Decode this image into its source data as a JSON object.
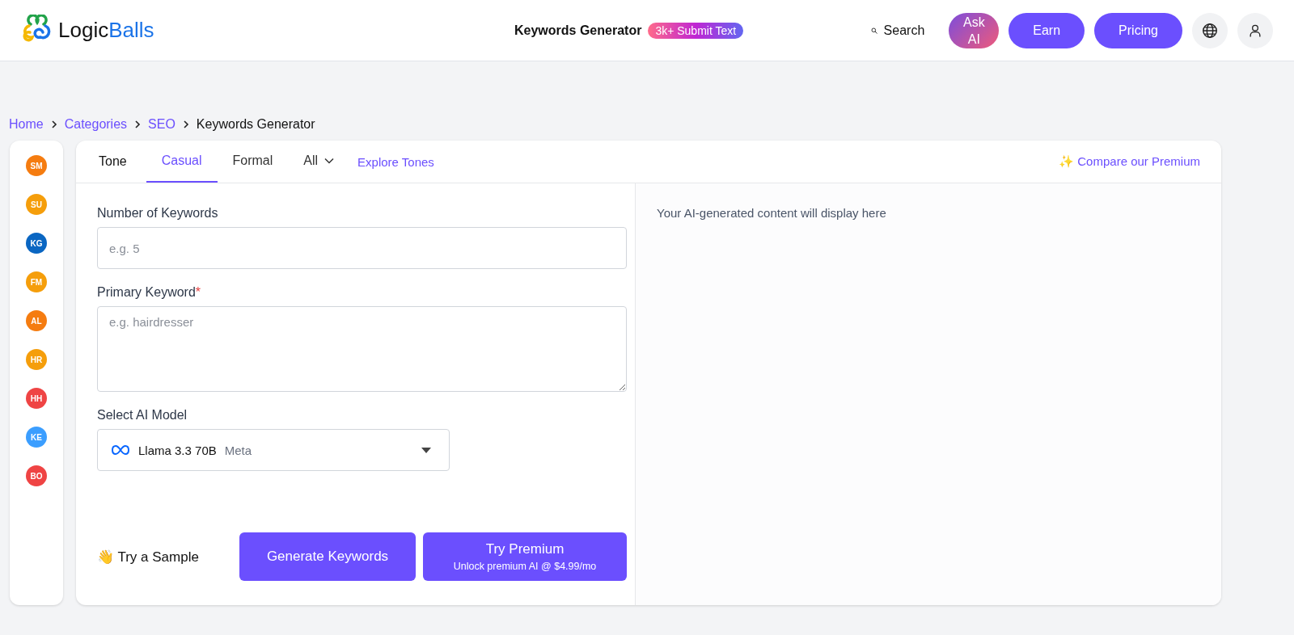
{
  "header": {
    "logo": {
      "first": "Logic",
      "second": "Balls"
    },
    "page_title": "Keywords Generator",
    "badge": "3k+ Submit Text",
    "search": "Search",
    "ask_ai": "Ask AI",
    "buttons": [
      "Earn",
      "Pricing"
    ]
  },
  "breadcrumb": [
    {
      "label": "Home",
      "link": true
    },
    {
      "label": "Categories",
      "link": true
    },
    {
      "label": "SEO",
      "link": true
    },
    {
      "label": "Keywords Generator",
      "link": false
    }
  ],
  "sidebar": [
    {
      "initials": "SM",
      "color": "#f57c10"
    },
    {
      "initials": "SU",
      "color": "#f59e0b"
    },
    {
      "initials": "KG",
      "color": "#0a66c2"
    },
    {
      "initials": "FM",
      "color": "#f59e0b"
    },
    {
      "initials": "AL",
      "color": "#f57c10"
    },
    {
      "initials": "HR",
      "color": "#f59e0b"
    },
    {
      "initials": "HH",
      "color": "#ef4444"
    },
    {
      "initials": "KE",
      "color": "#3b9eff"
    },
    {
      "initials": "BO",
      "color": "#ef4444"
    }
  ],
  "tone_bar": {
    "label": "Tone",
    "tabs": [
      {
        "label": "Casual",
        "selected": true
      },
      {
        "label": "Formal",
        "selected": false
      }
    ],
    "dropdown": "All",
    "explore": "Explore Tones",
    "compare": "✨ Compare our Premium"
  },
  "form": {
    "fields": [
      {
        "kind": "input",
        "label": "Number of Keywords",
        "placeholder": "e.g. 5"
      },
      {
        "kind": "textarea",
        "label": "Primary Keyword",
        "required_mark": "*",
        "placeholder": "e.g. hairdresser"
      }
    ],
    "model": {
      "label": "Select AI Model",
      "name": "Llama 3.3 70B",
      "vendor": "Meta"
    },
    "sample": "👋 Try a Sample",
    "generate": "Generate Keywords",
    "premium": {
      "title": "Try Premium",
      "subtitle": "Unlock premium AI @ $4.99/mo"
    }
  },
  "output": {
    "placeholder": "Your AI-generated content will display here"
  }
}
